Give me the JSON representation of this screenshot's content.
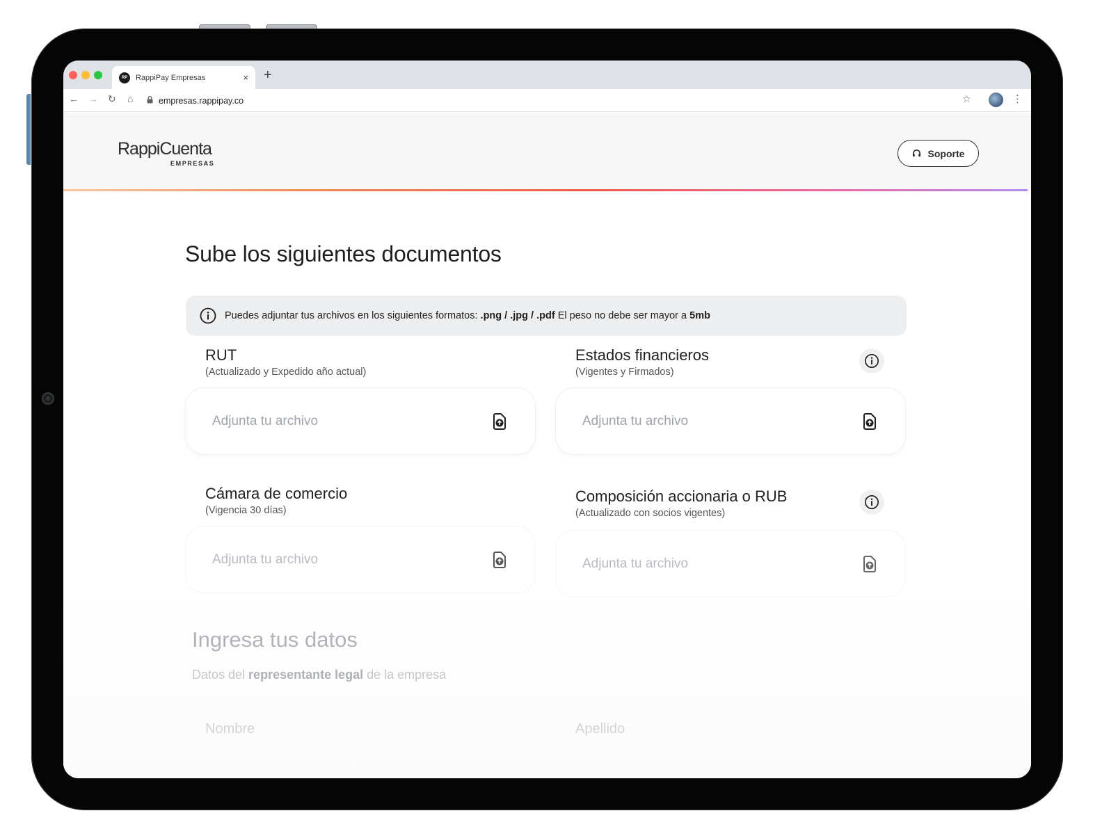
{
  "browser": {
    "tab_title": "RappiPay Empresas",
    "favicon_text": "RP",
    "tab_close": "×",
    "new_tab": "+",
    "url": "empresas.rappipay.co",
    "icons": [
      "back-arrow-icon",
      "forward-arrow-icon",
      "reload-icon",
      "home-icon",
      "lock-icon",
      "star-icon",
      "profile-avatar",
      "kebab-menu-icon"
    ]
  },
  "header": {
    "logo_main": "RappiCuenta",
    "logo_sub": "EMPRESAS",
    "support_label": "Soporte"
  },
  "documents": {
    "title": "Sube los siguientes documentos",
    "banner": {
      "text_prefix": "Puedes adjuntar tus archivos en los siguientes formatos: ",
      "formats": ".png / .jpg / .pdf",
      "text_middle": " El peso no debe ser mayor a ",
      "max_size": "5mb"
    },
    "items": [
      {
        "title": "RUT",
        "subtitle": "(Actualizado y Expedido año actual)",
        "placeholder": "Adjunta tu archivo",
        "has_info": false
      },
      {
        "title": "Estados financieros",
        "subtitle": "(Vigentes y Firmados)",
        "placeholder": "Adjunta tu archivo",
        "has_info": true
      },
      {
        "title": "Cámara de comercio",
        "subtitle": "(Vigencia 30 días)",
        "placeholder": "Adjunta tu archivo",
        "has_info": false
      },
      {
        "title": "Composición accionaria o RUB",
        "subtitle": "(Actualizado con socios vigentes)",
        "placeholder": "Adjunta tu archivo",
        "has_info": true
      }
    ]
  },
  "form": {
    "title": "Ingresa tus datos",
    "subtitle_prefix": "Datos del ",
    "subtitle_bold": "representante legal",
    "subtitle_suffix": " de la empresa",
    "first_name_label": "Nombre",
    "last_name_label": "Apellido"
  },
  "colors": {
    "tablet_bezel": "#050505",
    "header_bg": "#f6f6f7",
    "banner_bg": "#edeef0",
    "placeholder": "#9fa3aa",
    "accent_gradient": [
      "#f9c9a4",
      "#ef5a4c",
      "#e96aa3",
      "#b08ef0"
    ]
  }
}
